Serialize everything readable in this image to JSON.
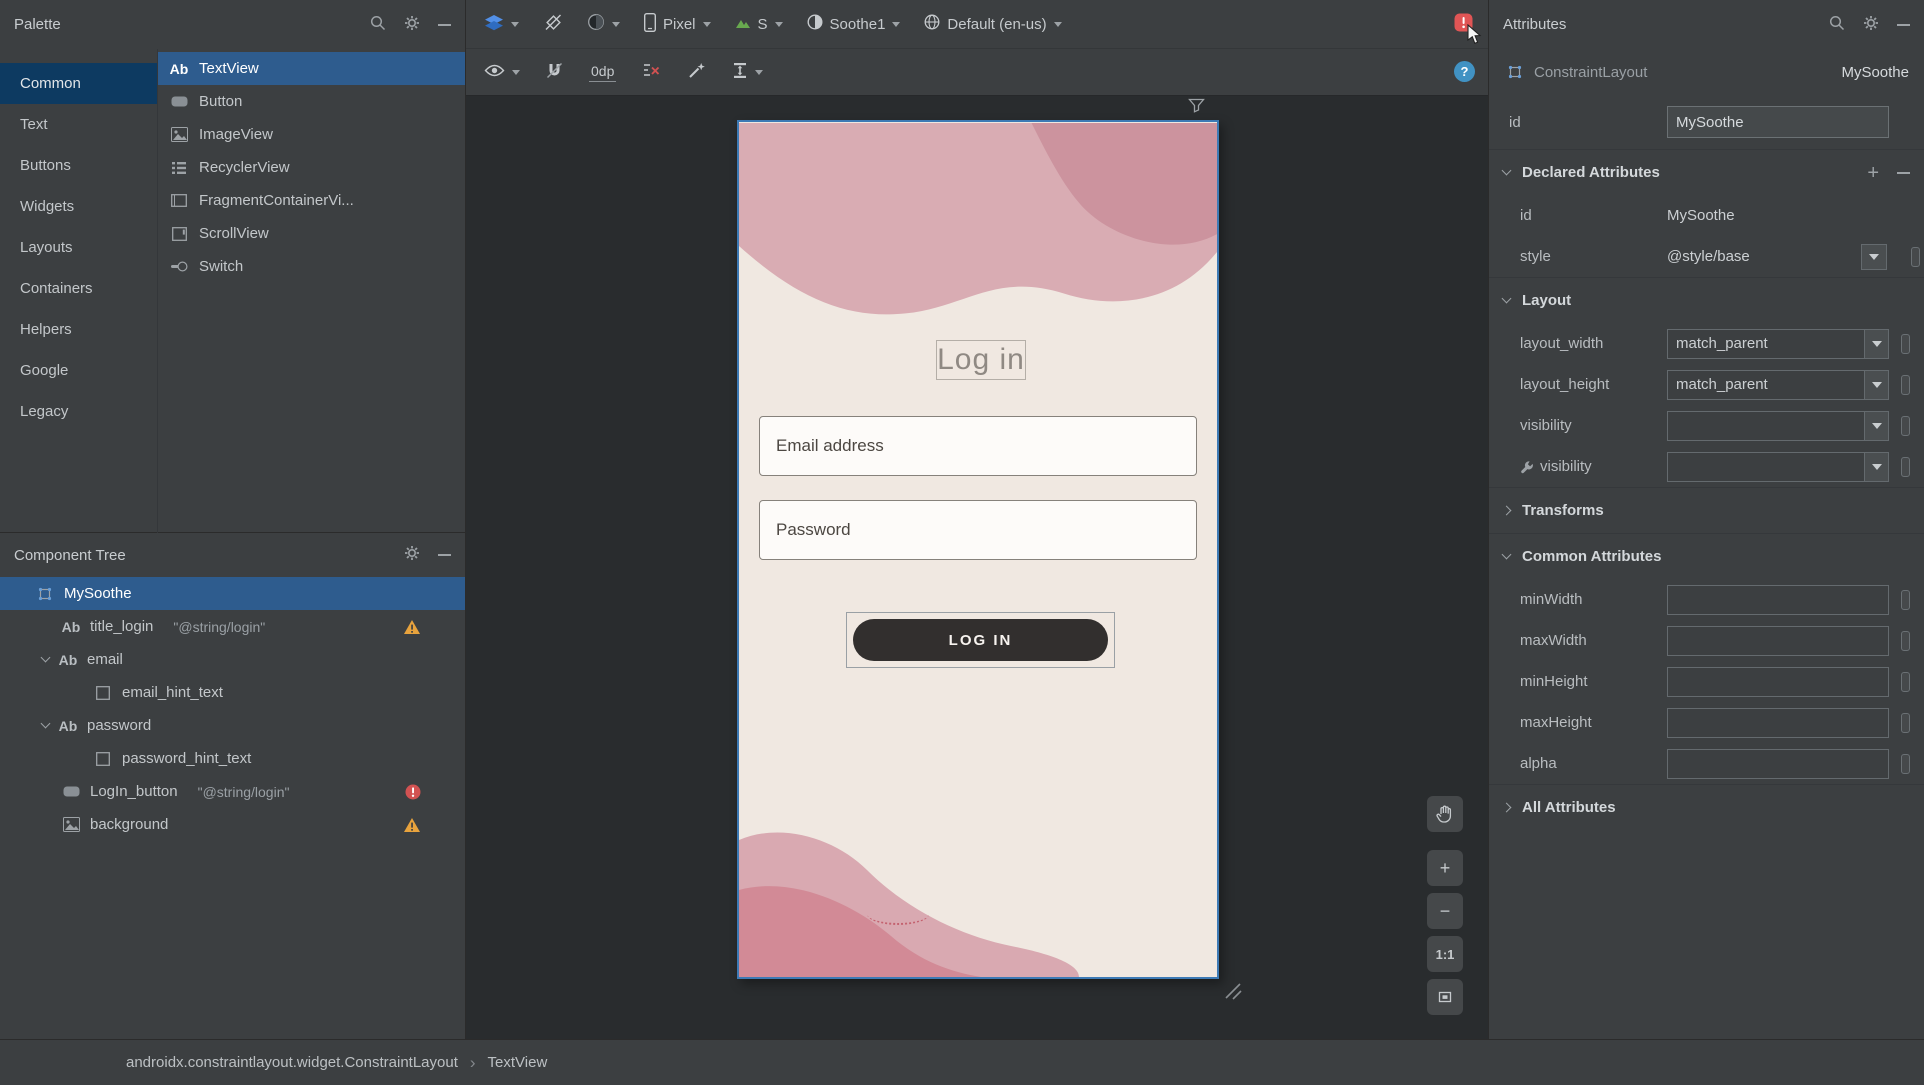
{
  "palette": {
    "title": "Palette",
    "selected_category": "Common",
    "categories": [
      "Common",
      "Text",
      "Buttons",
      "Widgets",
      "Layouts",
      "Containers",
      "Helpers",
      "Google",
      "Legacy"
    ],
    "components": [
      {
        "icon": "textview",
        "label": "TextView",
        "selected": true
      },
      {
        "icon": "button",
        "label": "Button",
        "selected": false
      },
      {
        "icon": "imageview",
        "label": "ImageView",
        "selected": false
      },
      {
        "icon": "recyclerview",
        "label": "RecyclerView",
        "selected": false
      },
      {
        "icon": "fragment",
        "label": "FragmentContainerVi...",
        "selected": false
      },
      {
        "icon": "scrollview",
        "label": "ScrollView",
        "selected": false
      },
      {
        "icon": "switch",
        "label": "Switch",
        "selected": false
      }
    ]
  },
  "component_tree": {
    "title": "Component Tree",
    "items": [
      {
        "icon": "constraintlayout",
        "label": "MySoothe",
        "indent": 0,
        "selected": true
      },
      {
        "icon": "textview",
        "label": "title_login",
        "value": "\"@string/login\"",
        "indent": 1,
        "badge": "warning"
      },
      {
        "icon": "textview",
        "label": "email",
        "indent": 1,
        "expand": true
      },
      {
        "icon": "view",
        "label": "email_hint_text",
        "indent": 2
      },
      {
        "icon": "textview",
        "label": "password",
        "indent": 1,
        "expand": true
      },
      {
        "icon": "view",
        "label": "password_hint_text",
        "indent": 2
      },
      {
        "icon": "button",
        "label": "LogIn_button",
        "value": "\"@string/login\"",
        "indent": 1,
        "badge": "error"
      },
      {
        "icon": "imageview",
        "label": "background",
        "indent": 1,
        "badge": "warning"
      }
    ]
  },
  "toolbar": {
    "device": "Pixel",
    "api_level": "S",
    "theme": "Soothe1",
    "locale": "Default (en-us)",
    "default_margin": "0dp",
    "help": "?"
  },
  "preview": {
    "title": "Log in",
    "email_hint": "Email address",
    "password_hint": "Password",
    "login_button": "LOG IN"
  },
  "zoom_controls": {
    "zoom_in": "+",
    "zoom_out": "−",
    "actual_size": "1:1"
  },
  "attributes": {
    "title": "Attributes",
    "component_type": "ConstraintLayout",
    "component_id": "MySoothe",
    "id_label": "id",
    "id_value": "MySoothe",
    "sections": [
      {
        "title": "Declared Attributes",
        "expanded": true,
        "actions": true,
        "rows": [
          {
            "label": "id",
            "value": "MySoothe",
            "control": "plain"
          },
          {
            "label": "style",
            "value": "@style/base",
            "control": "dropdown"
          }
        ]
      },
      {
        "title": "Layout",
        "expanded": true,
        "rows": [
          {
            "label": "layout_width",
            "value": "match_parent",
            "control": "combo"
          },
          {
            "label": "layout_height",
            "value": "match_parent",
            "control": "combo"
          },
          {
            "label": "visibility",
            "value": "",
            "control": "combo"
          },
          {
            "label": "visibility",
            "value": "",
            "control": "combo",
            "tool": true
          }
        ]
      },
      {
        "title": "Transforms",
        "expanded": false,
        "rows": []
      },
      {
        "title": "Common Attributes",
        "expanded": true,
        "rows": [
          {
            "label": "minWidth",
            "value": "",
            "control": "text"
          },
          {
            "label": "maxWidth",
            "value": "",
            "control": "text"
          },
          {
            "label": "minHeight",
            "value": "",
            "control": "text"
          },
          {
            "label": "maxHeight",
            "value": "",
            "control": "text"
          },
          {
            "label": "alpha",
            "value": "",
            "control": "text"
          }
        ]
      },
      {
        "title": "All Attributes",
        "expanded": false,
        "rows": []
      }
    ]
  },
  "statusbar": {
    "path": "androidx.constraintlayout.widget.ConstraintLayout",
    "separator": "›",
    "node": "TextView"
  }
}
